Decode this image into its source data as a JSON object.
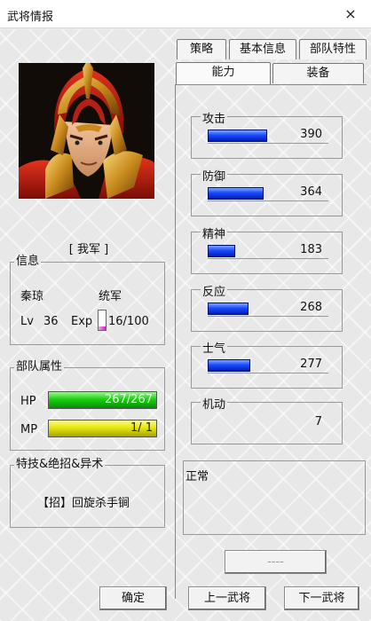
{
  "window": {
    "title": "武将情报",
    "close_icon": "×"
  },
  "hero": {
    "side": "[ 我军 ]",
    "info_legend": "信息",
    "name": "秦琼",
    "role": "统军",
    "lv_label": "Lv",
    "lv_value": "36",
    "exp_label": "Exp",
    "exp_value": "16/100",
    "exp_progress": 0.16
  },
  "unit": {
    "legend": "部队属性",
    "hp_label": "HP",
    "hp_value": "267/267",
    "hp_progress": 1.0,
    "mp_label": "MP",
    "mp_value": "1/  1",
    "mp_progress": 1.0
  },
  "skills": {
    "legend": "特技&绝招&异术",
    "item": "【招】回旋杀手锏"
  },
  "tabs": {
    "row1": [
      "策略",
      "基本信息",
      "部队特性"
    ],
    "row2": [
      "能力",
      "装备"
    ]
  },
  "stats": [
    {
      "name": "攻击",
      "value": "390",
      "progress": 0.49
    },
    {
      "name": "防御",
      "value": "364",
      "progress": 0.46
    },
    {
      "name": "精神",
      "value": "183",
      "progress": 0.23
    },
    {
      "name": "反应",
      "value": "268",
      "progress": 0.34
    },
    {
      "name": "士气",
      "value": "277",
      "progress": 0.35
    },
    {
      "name": "机动",
      "value": "7",
      "progress": 0
    }
  ],
  "status": {
    "text": "正常"
  },
  "buttons": {
    "placeholder": "----",
    "confirm": "确定",
    "prev": "上一武将",
    "next": "下一武将"
  },
  "colors": {
    "hp": "#12c40f",
    "mp": "#e3e50c",
    "stat_bar": "#1b49ff",
    "exp": "#e040d0"
  }
}
